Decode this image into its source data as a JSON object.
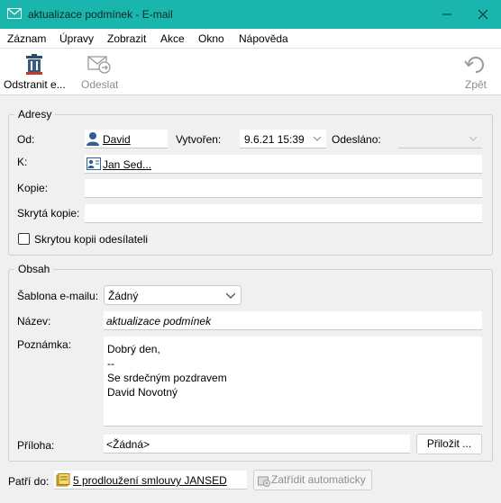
{
  "window": {
    "title": "aktualizace podmínek - E-mail"
  },
  "menu": [
    "Záznam",
    "Úpravy",
    "Zobrazit",
    "Akce",
    "Okno",
    "Nápověda"
  ],
  "toolbar": {
    "delete_label": "Odstranit e...",
    "send_label": "Odeslat",
    "back_label": "Zpět"
  },
  "addresses": {
    "legend": "Adresy",
    "from_label": "Od:",
    "from_value": "David",
    "created_label": "Vytvořen:",
    "created_value": "9.6.21 15:39",
    "sent_label": "Odesláno:",
    "sent_value": "",
    "to_label": "K:",
    "to_value": "Jan Sed...",
    "cc_label": "Kopie:",
    "cc_value": "",
    "bcc_label": "Skrytá kopie:",
    "bcc_value": "",
    "bcc_sender_label": "Skrytou kopii odesílateli",
    "bcc_sender_checked": false
  },
  "content": {
    "legend": "Obsah",
    "template_label": "Šablona e-mailu:",
    "template_value": "Žádný",
    "subject_label": "Název:",
    "subject_value": "aktualizace podmínek",
    "note_label": "Poznámka:",
    "note_lines": [
      "Dobrý den,",
      "--",
      "Se srdečným pozdravem",
      "David Novotný"
    ],
    "attachment_label": "Příloha:",
    "attachment_value": "<Žádná>",
    "attach_button": "Přiložit ..."
  },
  "footer": {
    "belongs_label": "Patří do:",
    "belongs_value": "5 prodloužení smlouvy JANSED",
    "auto_file_label": "Zatřídit automaticky"
  },
  "colors": {
    "titlebar": "#1ab5ad",
    "delete_icon": "#c0392b"
  }
}
